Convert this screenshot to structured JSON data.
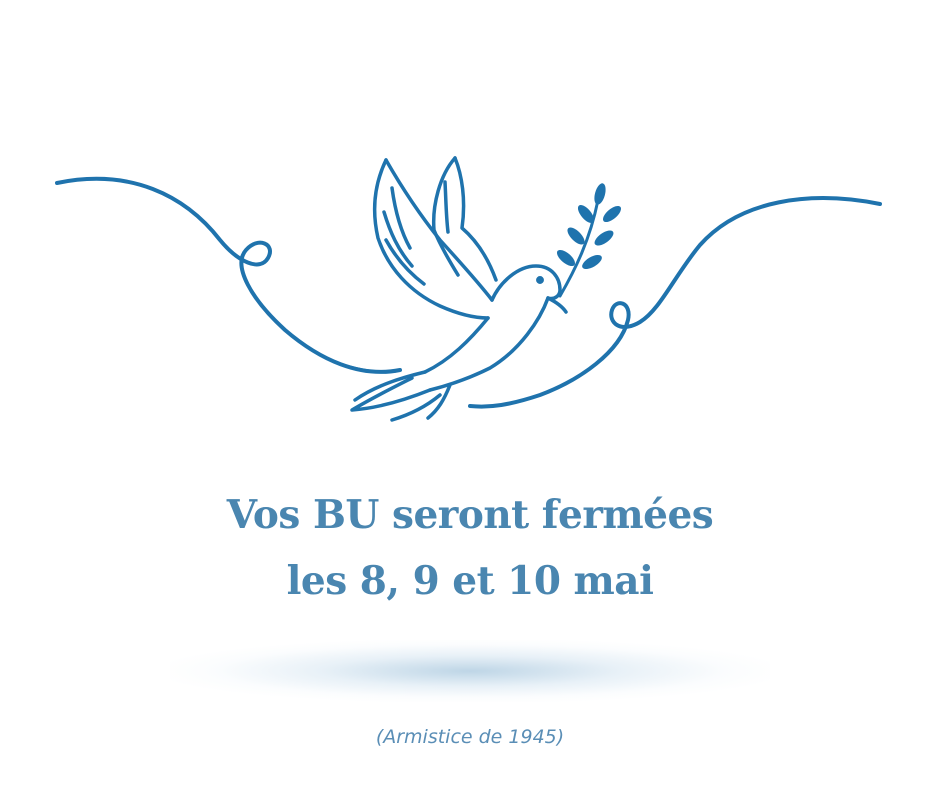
{
  "headline": {
    "line1": "Vos BU seront fermées",
    "line2": "les 8, 9 et 10 mai"
  },
  "footnote": "(Armistice de 1945)",
  "illustration": {
    "icon": "peace-dove-icon",
    "branch_icon": "olive-branch-icon"
  },
  "colors": {
    "primary": "#1f73ad",
    "headline": "#4a86b0",
    "footnote": "#5a8eb6",
    "background": "#ffffff"
  }
}
